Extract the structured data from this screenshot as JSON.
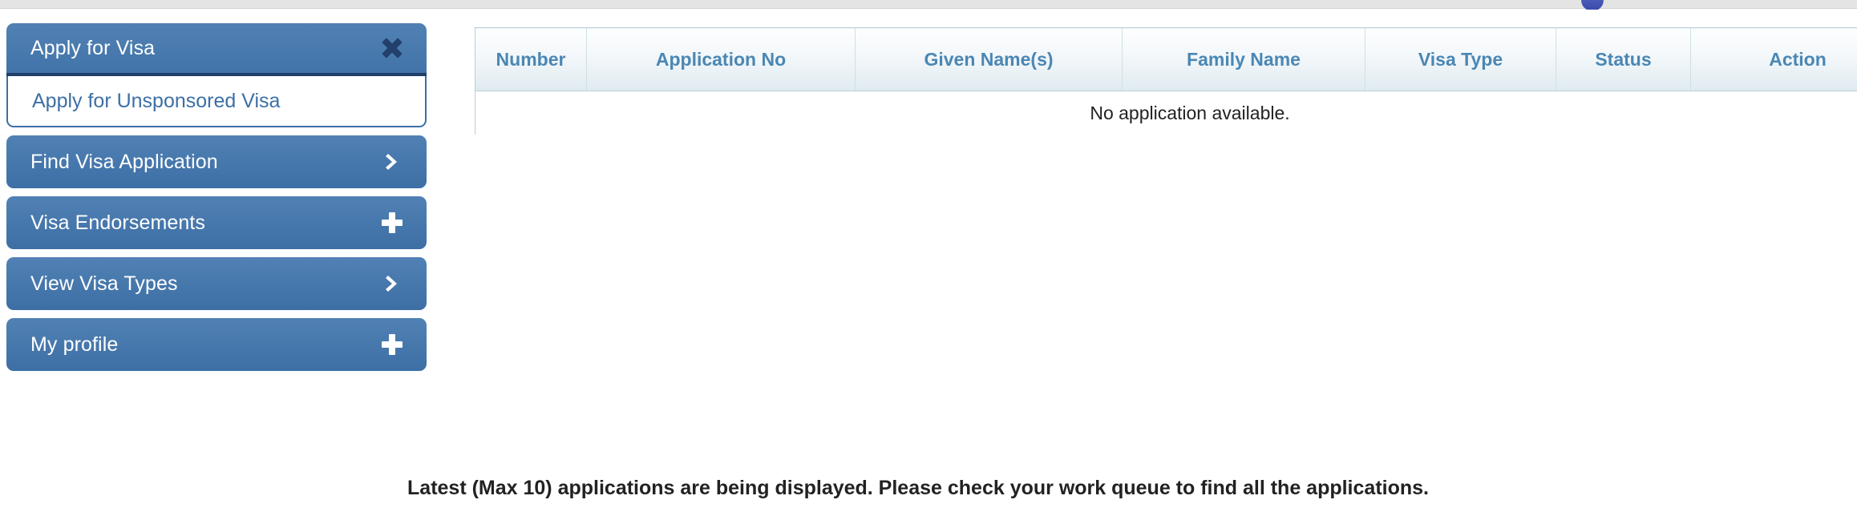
{
  "window": {
    "top_strip_badge_icon": "circle-badge-icon"
  },
  "sidebar": {
    "groups": [
      {
        "label": "Apply for Visa",
        "marker_icon": "close-x-icon",
        "expanded": true,
        "children": [
          {
            "label": "Apply for Unsponsored Visa"
          }
        ]
      },
      {
        "label": "Find Visa Application",
        "marker_icon": "chevron-right-icon",
        "expanded": false,
        "children": []
      },
      {
        "label": "Visa Endorsements",
        "marker_icon": "plus-icon",
        "expanded": false,
        "children": []
      },
      {
        "label": "View Visa Types",
        "marker_icon": "chevron-right-icon",
        "expanded": false,
        "children": []
      },
      {
        "label": "My profile",
        "marker_icon": "plus-icon",
        "expanded": false,
        "children": []
      }
    ]
  },
  "applications_table": {
    "columns": [
      "Number",
      "Application No",
      "Given Name(s)",
      "Family Name",
      "Visa Type",
      "Status",
      "Action"
    ],
    "rows": [],
    "empty_message": "No application available."
  },
  "footer": {
    "note": "Latest (Max 10) applications are being displayed. Please check your work queue to find all the applications."
  },
  "colors": {
    "menu_blue": "#4274a9",
    "menu_blue_light": "#5181b4",
    "menu_border_dark": "#1f3f68",
    "link_blue": "#3d6fa5",
    "table_header_text": "#4a87b4",
    "table_border": "#b7ced9",
    "top_strip": "#e4e4e4",
    "badge_blue": "#3949ab"
  }
}
